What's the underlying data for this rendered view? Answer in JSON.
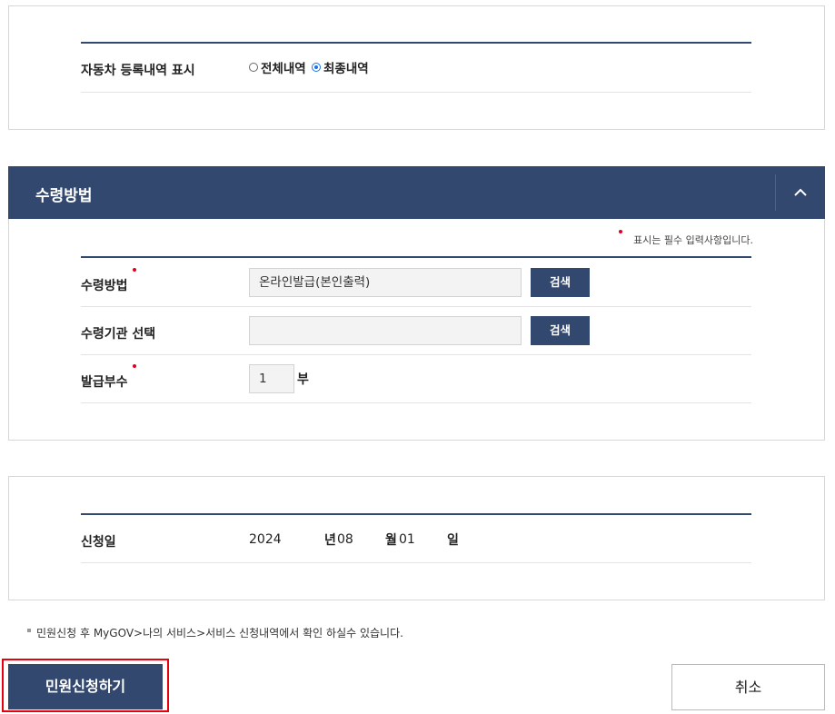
{
  "display_section": {
    "label": "자동차 등록내역 표시",
    "options": [
      {
        "label": "전체내역",
        "selected": false
      },
      {
        "label": "최종내역",
        "selected": true
      }
    ]
  },
  "receipt_section": {
    "title": "수령방법",
    "required_note": "표시는 필수 입력사항입니다.",
    "method": {
      "label": "수령방법",
      "value": "온라인발급(본인출력)",
      "search_label": "검색"
    },
    "agency": {
      "label": "수령기관 선택",
      "value": "",
      "search_label": "검색"
    },
    "copies": {
      "label": "발급부수",
      "value": "1",
      "unit": "부"
    }
  },
  "date_section": {
    "label": "신청일",
    "year": "2024",
    "year_unit": "년",
    "month": "08",
    "month_unit": "월",
    "day": "01",
    "day_unit": "일"
  },
  "notice": "민원신청 후 MyGOV>나의 서비스>서비스 신청내역에서 확인 하실수 있습니다.",
  "actions": {
    "submit_label": "민원신청하기",
    "cancel_label": "취소"
  },
  "colors": {
    "primary": "#33486f",
    "required": "#e0001b",
    "highlight": "#e8000b"
  }
}
